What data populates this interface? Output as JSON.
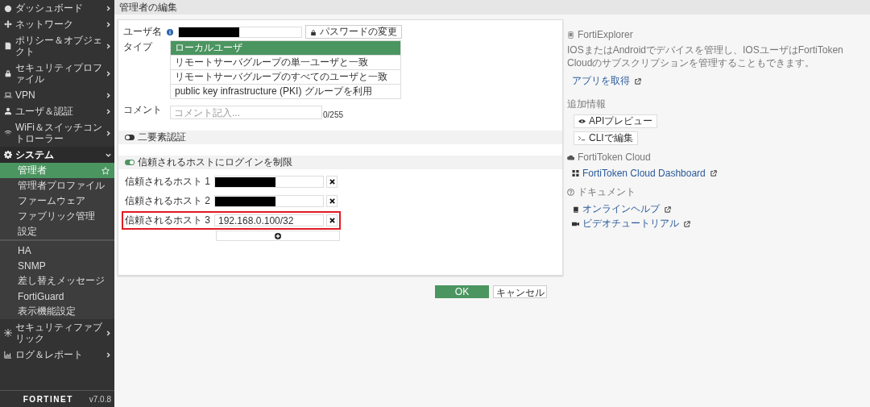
{
  "sidebar": {
    "items": [
      {
        "label": "ダッシュボード",
        "expanded": false
      },
      {
        "label": "ネットワーク",
        "expanded": false
      },
      {
        "label": "ポリシー＆オブジェクト",
        "expanded": false
      },
      {
        "label": "セキュリティプロファイル",
        "expanded": false
      },
      {
        "label": "VPN",
        "expanded": false
      },
      {
        "label": "ユーザ＆認証",
        "expanded": false
      },
      {
        "label": "WiFi＆スイッチコントローラー",
        "expanded": false
      },
      {
        "label": "システム",
        "expanded": true,
        "child_groups": [
          [
            {
              "label": "管理者",
              "selected": true
            },
            {
              "label": "管理者プロファイル",
              "selected": false
            },
            {
              "label": "ファームウェア",
              "selected": false
            },
            {
              "label": "ファブリック管理",
              "selected": false
            },
            {
              "label": "設定",
              "selected": false
            }
          ],
          [
            {
              "label": "HA",
              "selected": false
            },
            {
              "label": "SNMP",
              "selected": false
            },
            {
              "label": "差し替えメッセージ",
              "selected": false
            },
            {
              "label": "FortiGuard",
              "selected": false
            },
            {
              "label": "表示機能設定",
              "selected": false
            }
          ]
        ]
      },
      {
        "label": "セキュリティファブリック",
        "expanded": false
      },
      {
        "label": "ログ＆レポート",
        "expanded": false
      }
    ],
    "logo": "FORTINET",
    "version": "v7.0.8"
  },
  "page_title": "管理者の編集",
  "form": {
    "username": {
      "label": "ユーザ名",
      "redacted": true
    },
    "password_button": "パスワードの変更",
    "type": {
      "label": "タイプ",
      "options": [
        {
          "label": "ローカルユーザ",
          "selected": true
        },
        {
          "label": "リモートサーバグループの単一ユーザと一致",
          "selected": false
        },
        {
          "label": "リモートサーバグループのすべてのユーザと一致",
          "selected": false
        },
        {
          "label": "public key infrastructure (PKI) グループを利用",
          "selected": false
        }
      ]
    },
    "comment": {
      "label": "コメント",
      "placeholder": "コメント記入...",
      "counter": "0/255"
    },
    "toggles": [
      {
        "label": "二要素認証",
        "on": false
      },
      {
        "label": "信頼されるホストにログインを制限",
        "on": true
      }
    ],
    "trusted_hosts": [
      {
        "label": "信頼されるホスト 1",
        "redacted": true,
        "highlighted": false
      },
      {
        "label": "信頼されるホスト 2",
        "redacted": true,
        "highlighted": false
      },
      {
        "label": "信頼されるホスト 3",
        "value": "192.168.0.100/32",
        "redacted": false,
        "highlighted": true
      }
    ]
  },
  "buttons": [
    "OK",
    "キャンセル"
  ],
  "side_panel": {
    "forti_explorer": {
      "heading": "FortiExplorer",
      "text": "IOSまたはAndroidでデバイスを管理し、IOSユーザはFortiToken Cloudのサブスクリプションを管理することもできます。",
      "link": "アプリを取得"
    },
    "additional": {
      "heading": "追加情報",
      "buttons": [
        "APIプレビュー",
        "CLIで編集"
      ]
    },
    "forti_token": {
      "heading": "FortiToken Cloud",
      "link": "FortiToken Cloud Dashboard"
    },
    "docs": {
      "heading": "ドキュメント",
      "links": [
        "オンラインヘルプ",
        "ビデオチュートリアル"
      ]
    }
  }
}
